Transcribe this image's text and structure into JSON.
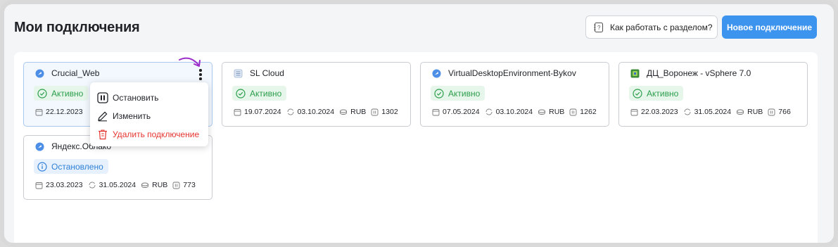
{
  "header": {
    "title": "Мои подключения",
    "help_label": "Как работать с разделом?",
    "new_label": "Новое подключение"
  },
  "colors": {
    "accent": "#3d94ee",
    "active": "#2b9e4b",
    "stopped": "#2f7fd6",
    "danger": "#e5342f",
    "annotation": "#9b2cc9"
  },
  "cards": [
    {
      "name": "Crucial_Web",
      "status": "Активно",
      "created": "22.12.2023",
      "icon": "crucial-icon"
    },
    {
      "name": "SL Cloud",
      "status": "Активно",
      "created": "19.07.2024",
      "updated": "03.10.2024",
      "currency": "RUB",
      "count": "1302",
      "icon": "sl-cloud-icon"
    },
    {
      "name": "VirtualDesktopEnvironment-Bykov",
      "status": "Активно",
      "created": "07.05.2024",
      "updated": "03.10.2024",
      "currency": "RUB",
      "count": "1262",
      "icon": "vde-icon"
    },
    {
      "name": "ДЦ_Воронеж - vSphere 7.0",
      "status": "Активно",
      "created": "22.03.2023",
      "updated": "31.05.2024",
      "currency": "RUB",
      "count": "766",
      "icon": "vsphere-icon"
    },
    {
      "name": "Яндекс.Облако",
      "status": "Остановлено",
      "created": "23.03.2023",
      "updated": "31.05.2024",
      "currency": "RUB",
      "count": "773",
      "icon": "yandex-icon"
    }
  ],
  "menu": {
    "stop": "Остановить",
    "edit": "Изменить",
    "delete": "Удалить подключение"
  }
}
